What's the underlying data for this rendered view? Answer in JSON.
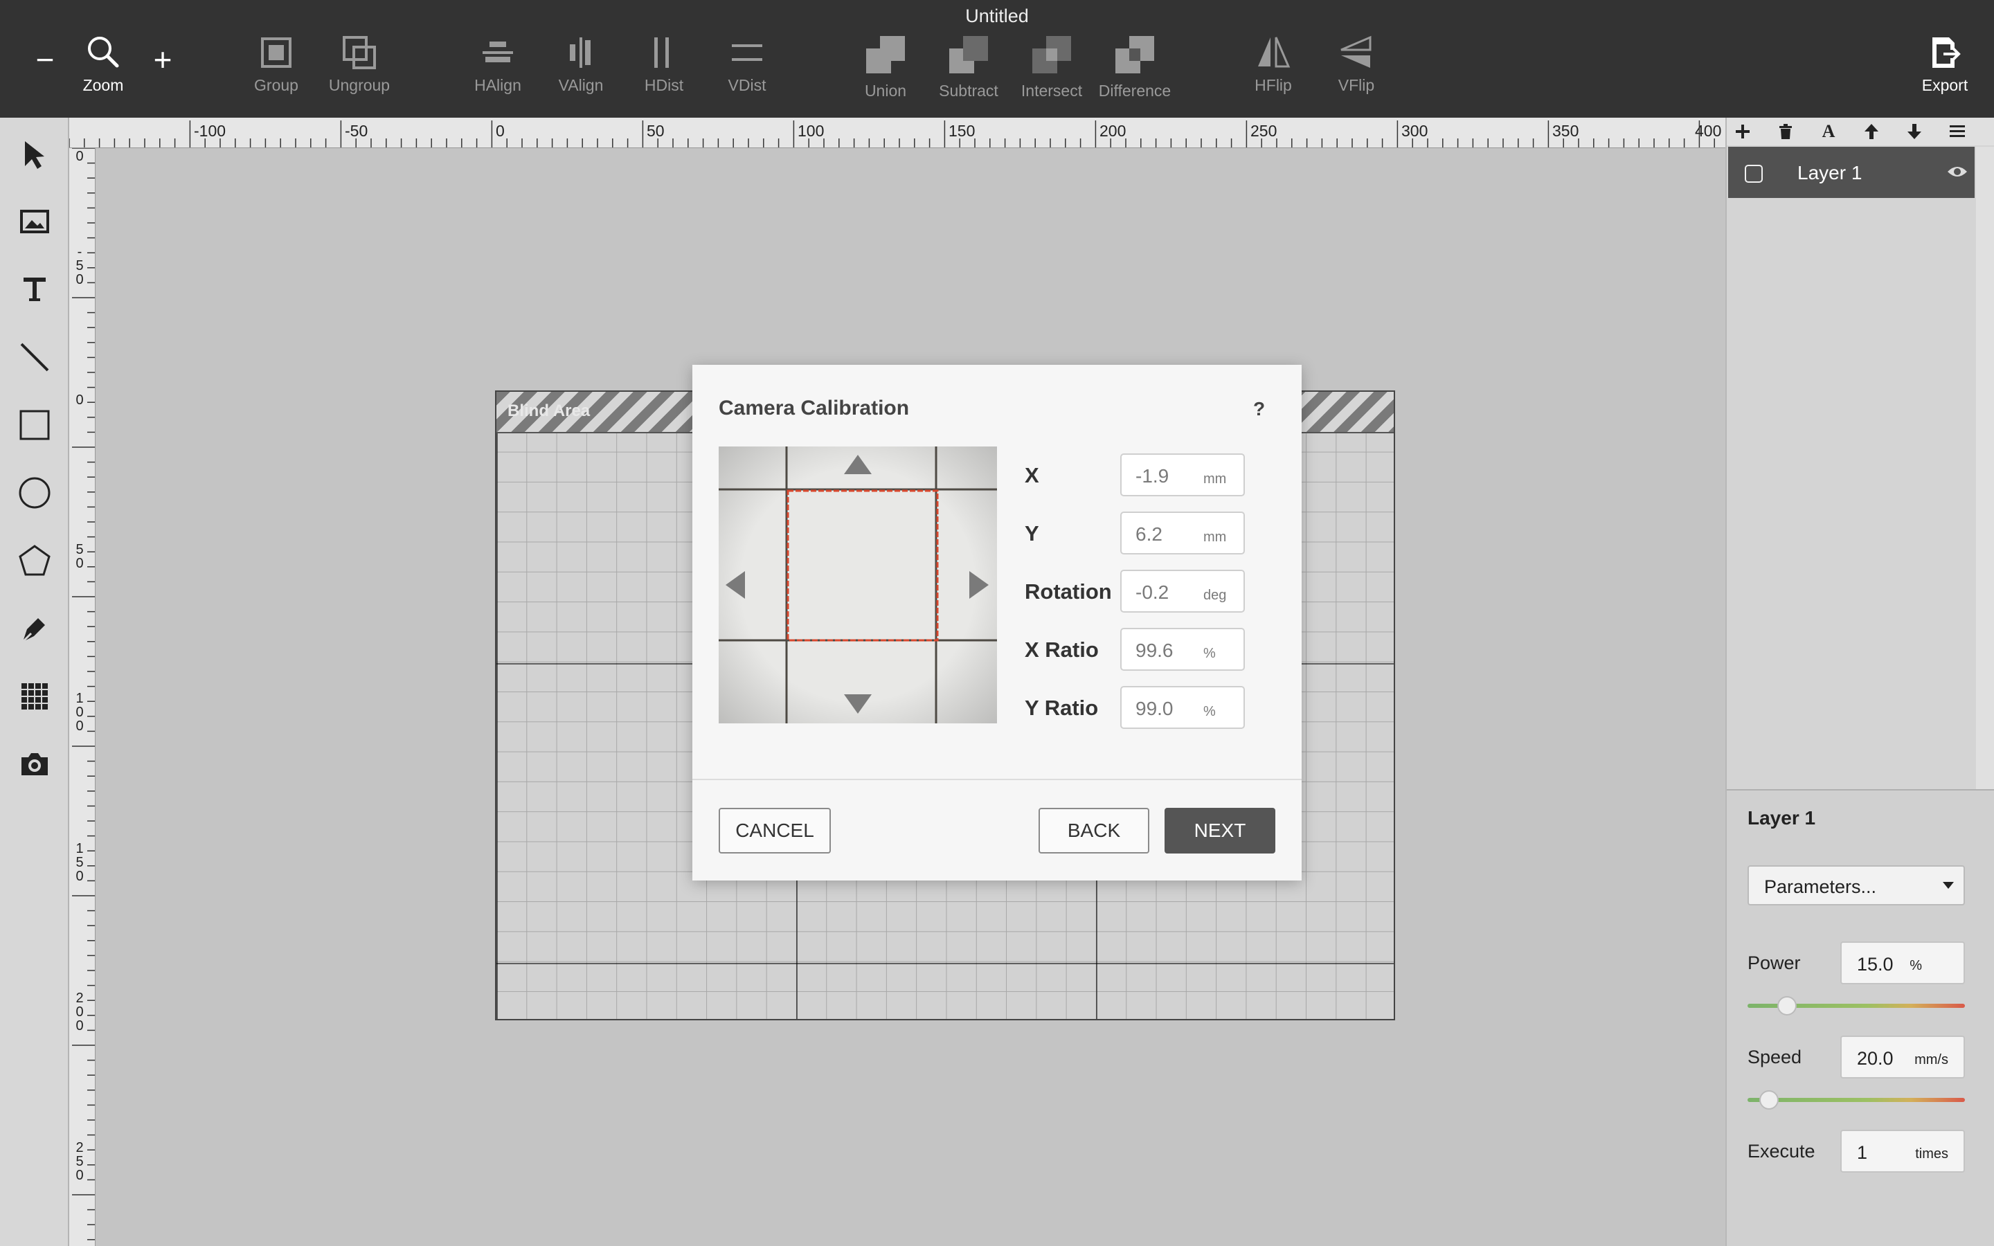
{
  "window": {
    "title": "Untitled"
  },
  "toolbar": {
    "zoom_label": "Zoom",
    "group": "Group",
    "ungroup": "Ungroup",
    "halign": "HAlign",
    "valign": "VAlign",
    "hdist": "HDist",
    "vdist": "VDist",
    "union": "Union",
    "subtract": "Subtract",
    "intersect": "Intersect",
    "difference": "Difference",
    "hflip": "HFlip",
    "vflip": "VFlip",
    "export": "Export"
  },
  "left_tools": [
    "cursor-icon",
    "image-icon",
    "text-icon",
    "line-icon",
    "rectangle-icon",
    "ellipse-icon",
    "polygon-icon",
    "pen-icon",
    "grid-icon",
    "camera-icon"
  ],
  "ruler": {
    "top_labels": [
      "-100",
      "-50",
      "0",
      "50",
      "100",
      "150",
      "200",
      "250",
      "300",
      "350",
      "400"
    ],
    "left_labels": [
      "0",
      "-50",
      "0",
      "50",
      "100",
      "150",
      "200",
      "250"
    ]
  },
  "canvas": {
    "blind_area_label": "Blind Area"
  },
  "layers_panel": {
    "layers": [
      {
        "name": "Layer 1",
        "visible": true
      }
    ],
    "toolbar_icons": [
      "plus-icon",
      "trash-icon",
      "font-icon",
      "arrow-up-icon",
      "arrow-down-icon",
      "menu-icon"
    ]
  },
  "layer_props": {
    "title": "Layer 1",
    "parameters_select": "Parameters...",
    "power_label": "Power",
    "power_value": "15.0",
    "power_unit": "%",
    "power_fraction": 0.15,
    "speed_label": "Speed",
    "speed_value": "20.0",
    "speed_unit": "mm/s",
    "speed_fraction": 0.06,
    "execute_label": "Execute",
    "execute_value": "1",
    "execute_unit": "times"
  },
  "modal": {
    "title": "Camera Calibration",
    "help": "?",
    "fields": [
      {
        "label": "X",
        "value": "-1.9",
        "unit": "mm"
      },
      {
        "label": "Y",
        "value": "6.2",
        "unit": "mm"
      },
      {
        "label": "Rotation",
        "value": "-0.2",
        "unit": "deg"
      },
      {
        "label": "X Ratio",
        "value": "99.6",
        "unit": "%"
      },
      {
        "label": "Y Ratio",
        "value": "99.0",
        "unit": "%"
      }
    ],
    "cancel": "CANCEL",
    "back": "BACK",
    "next": "NEXT"
  },
  "colors": {
    "toolbar_bg": "#333333",
    "primary_button": "#555555",
    "calibration_line": "#d9482e"
  }
}
